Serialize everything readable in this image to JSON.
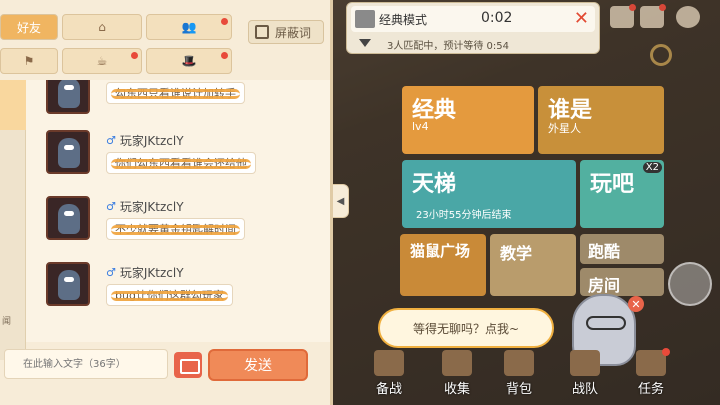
{
  "chat": {
    "tabs": [
      {
        "label": "好友",
        "active": true
      },
      {
        "label": "",
        "icon": "house-icon"
      },
      {
        "label": "",
        "icon": "group-icon"
      },
      {
        "label": "",
        "icon": "flag-icon"
      },
      {
        "label": "",
        "icon": "teapot-icon"
      },
      {
        "label": "",
        "icon": "hat-icon"
      }
    ],
    "block_label": "屏蔽词",
    "sidebar_label": "闻",
    "messages": [
      {
        "user": "",
        "text": "勾东西只看谁说计加转手"
      },
      {
        "user": "玩家JKtzclY",
        "text": "你们勾东西看看谁会还给他"
      },
      {
        "user": "玩家JKtzclY",
        "text": "不少就要黄金钥匙解时间"
      },
      {
        "user": "玩家JKtzclY",
        "text": "bug让你们这群勾玩家"
      }
    ],
    "input_placeholder": "在此输入文字（36字）",
    "send_label": "发送"
  },
  "match": {
    "mode": "经典模式",
    "timer": "0:02",
    "status": "3人匹配中，预计等待 0:54"
  },
  "tiles": {
    "classic": {
      "title": "经典",
      "sub": "lv4"
    },
    "alien": {
      "title": "谁是",
      "sub": "外星人"
    },
    "ladder": {
      "title": "天梯",
      "sub": "23小时55分钟后结束"
    },
    "play": {
      "title": "玩吧",
      "badge": "X2"
    },
    "plaza": {
      "title": "猫鼠广场"
    },
    "teach": {
      "title": "教学"
    },
    "parkour": {
      "title": "跑酷"
    },
    "room": {
      "title": "房间"
    }
  },
  "tooltip": "等得无聊吗？点我~",
  "bottom_nav": [
    "备战",
    "收集",
    "背包",
    "战队",
    "任务"
  ],
  "colors": {
    "accent": "#f08a58",
    "tile_orange": "#e49a3e",
    "tile_teal": "#4aa7a6",
    "badge_red": "#e84a3a"
  }
}
